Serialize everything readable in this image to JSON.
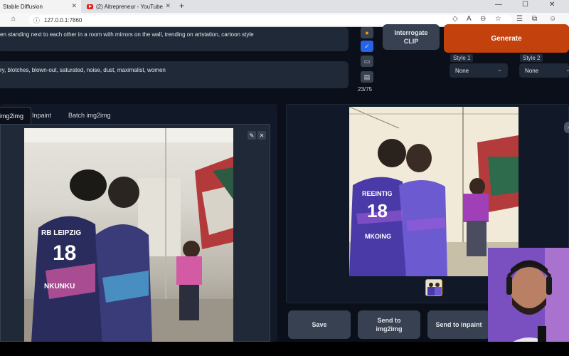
{
  "browser": {
    "tabs": [
      {
        "label": "Stable Diffusion",
        "active": true
      },
      {
        "label": "(2) Aitrepreneur - YouTube",
        "active": false
      }
    ],
    "url": "127.0.0.1:7860",
    "new_tab_symbol": "+"
  },
  "prompt": {
    "positive": "en standing next to each other in a room with mirrors on the wall, trending on artstation, cartoon style",
    "negative": "ry, blotches, blown-out, saturated, noise, dust, maximalist, women"
  },
  "tools": {
    "token_counter": "23/75"
  },
  "buttons": {
    "interrogate_line1": "Interrogate",
    "interrogate_line2": "CLIP",
    "generate": "Generate"
  },
  "styles": {
    "style1_label": "Style 1",
    "style1_value": "None",
    "style2_label": "Style 2",
    "style2_value": "None"
  },
  "mode_tabs": [
    {
      "label": "img2img",
      "active": true
    },
    {
      "label": "Inpaint",
      "active": false
    },
    {
      "label": "Batch img2img",
      "active": false
    }
  ],
  "input_image": {
    "jersey_left_text": "RB LEIPZIG",
    "jersey_left_number": "18",
    "jersey_left_name": "NKUNKU"
  },
  "output_image": {
    "jersey_text": "REEINTIG",
    "jersey_number": "18",
    "jersey_name": "MKOING"
  },
  "actions": {
    "save": "Save",
    "send_img2img_line1": "Send to",
    "send_img2img_line2": "img2img",
    "send_inpaint": "Send to inpaint"
  },
  "colors": {
    "background": "#0b0f19",
    "panel": "#1f2937",
    "generate": "#c2410c"
  }
}
